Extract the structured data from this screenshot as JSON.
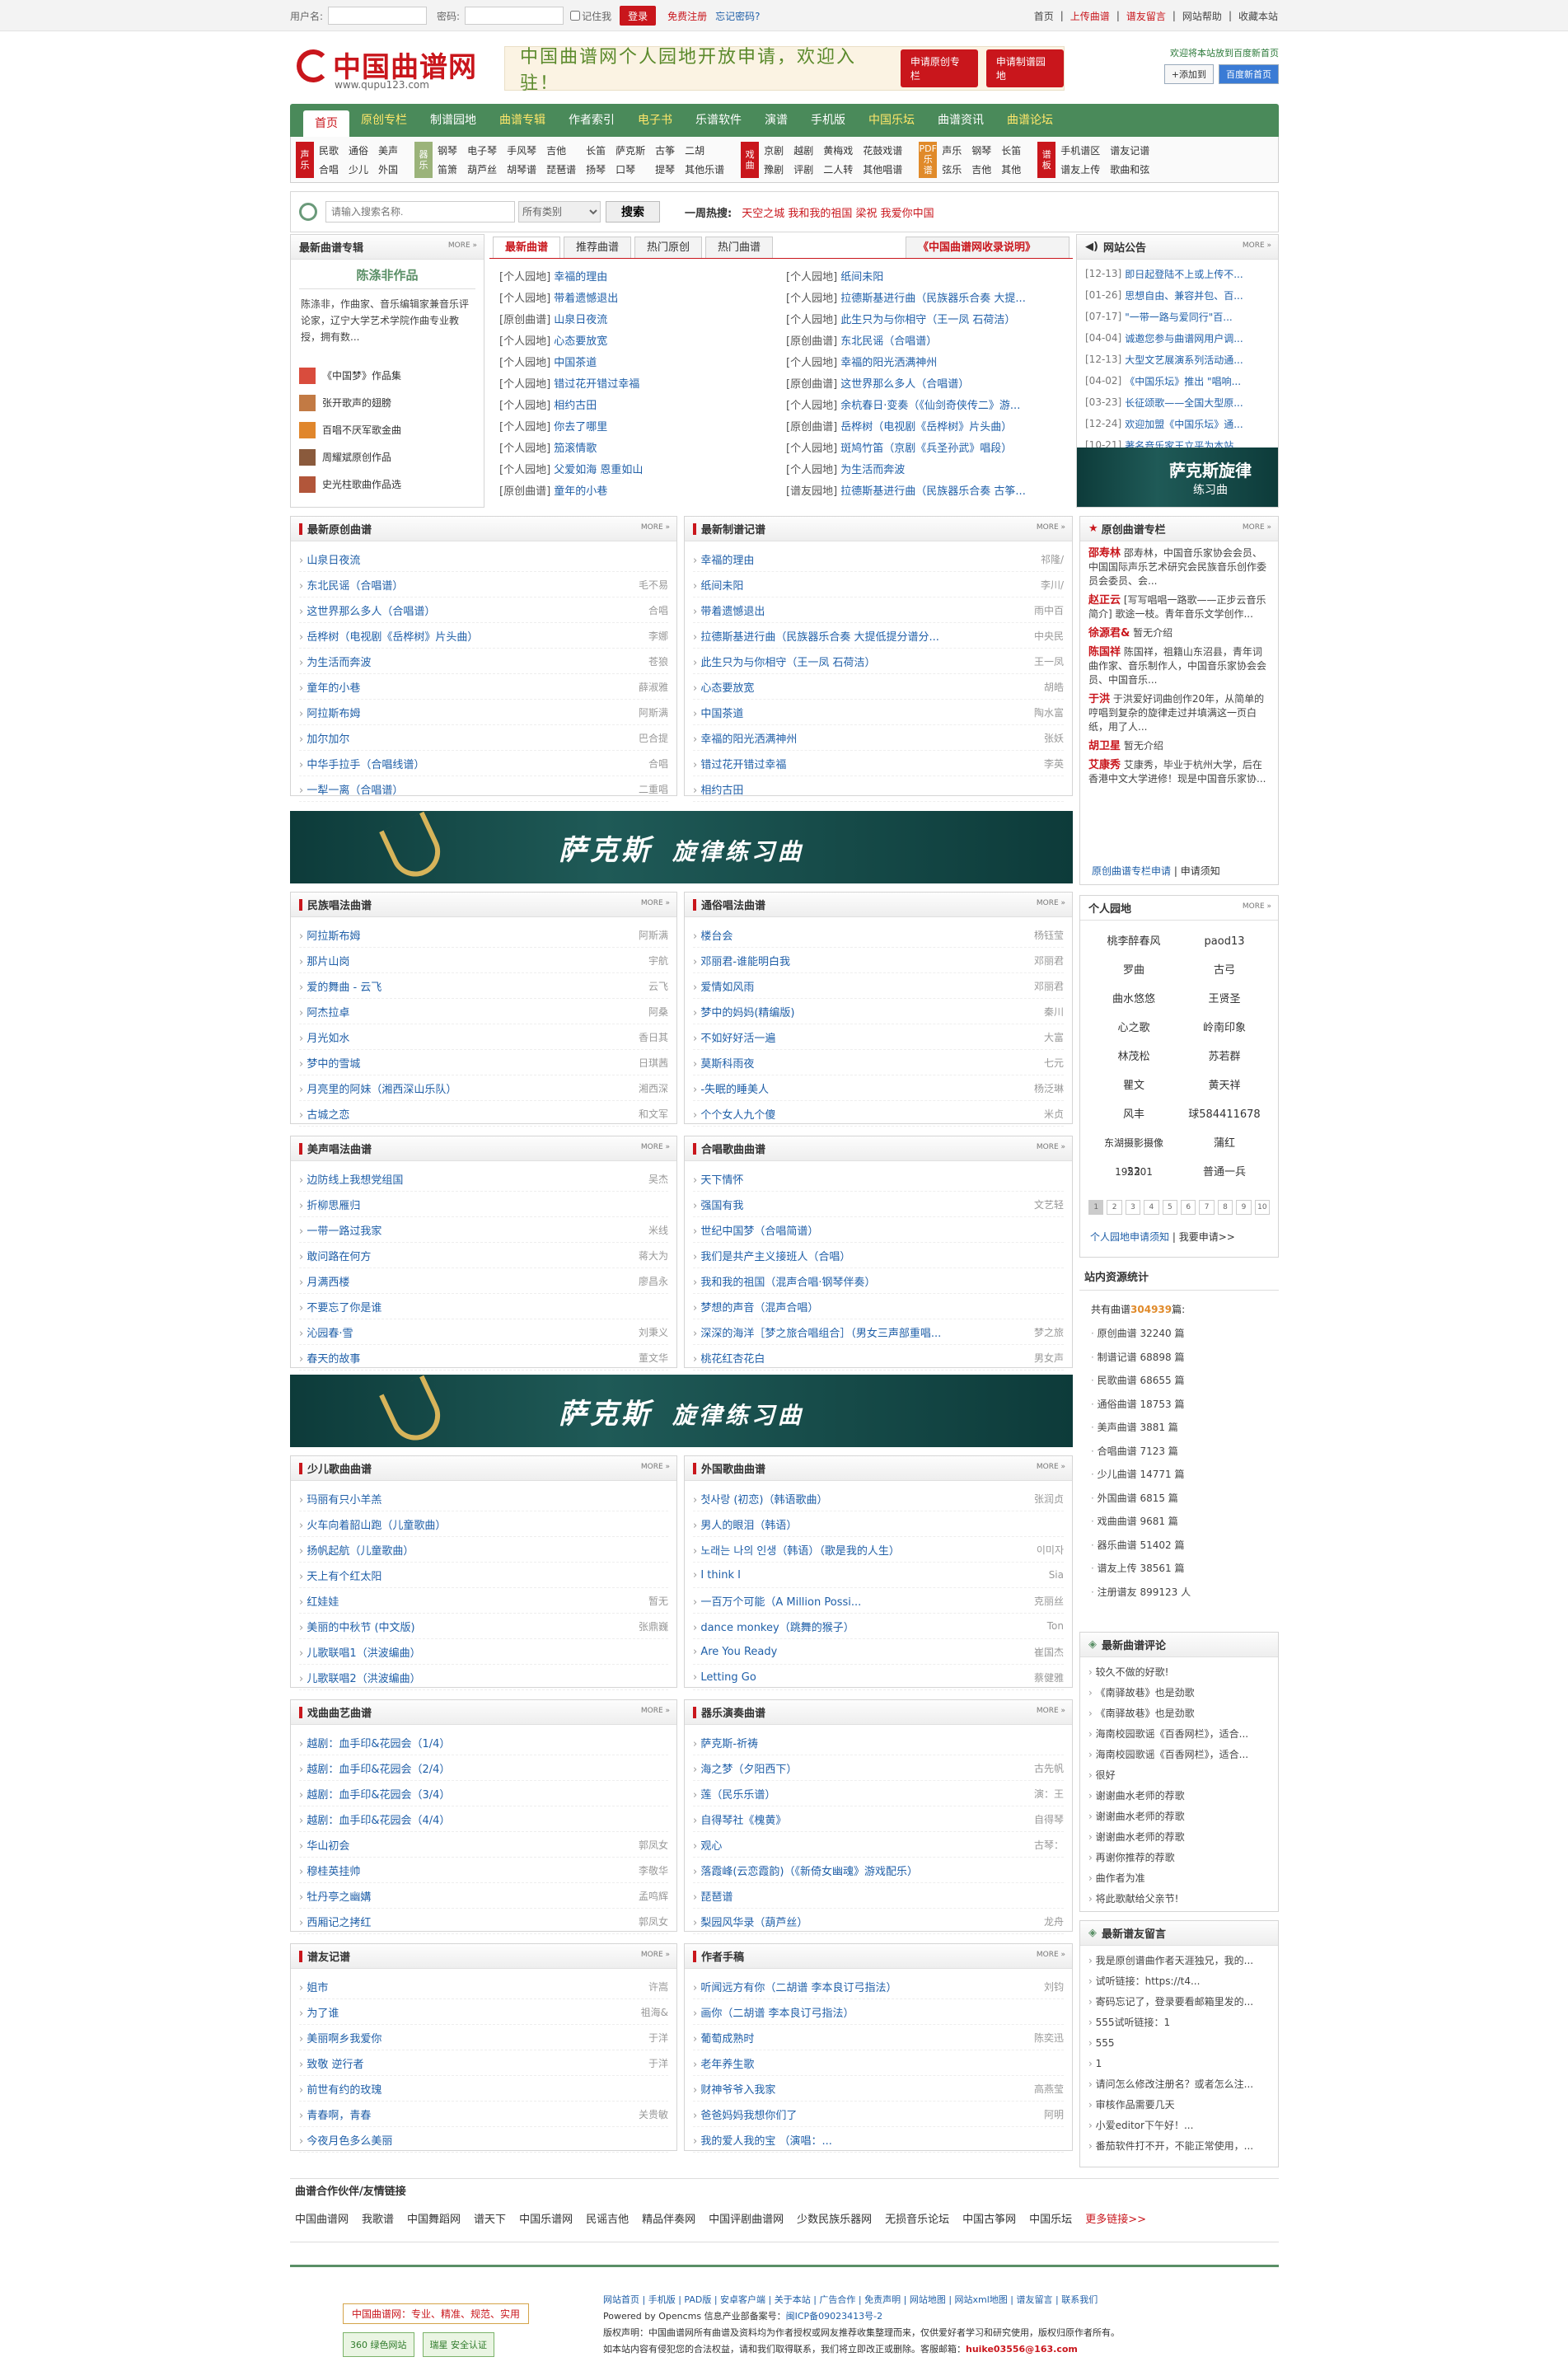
{
  "topbar": {
    "user_label": "用户名:",
    "pass_label": "密码:",
    "remember": "记住我",
    "login": "登录",
    "register": "免费注册",
    "forgot": "忘记密码?",
    "links": [
      "首页",
      "上传曲谱",
      "谱友留言",
      "网站帮助",
      "收藏本站"
    ]
  },
  "header": {
    "logo": "中国曲谱网",
    "url": "www.qupu123.com",
    "slogan": "中国曲谱网个人园地开放申请，欢迎入驻！",
    "btn1": "申请原创专栏",
    "btn2": "申请制谱园地",
    "right_note": "欢迎将本站放到百度新首页",
    "add": "+添加到",
    "baidu": "百度新首页"
  },
  "nav": [
    "首页",
    "原创专栏",
    "制谱园地",
    "曲谱专辑",
    "作者索引",
    "电子书",
    "乐谱软件",
    "演谱",
    "手机版",
    "中国乐坛",
    "曲谱资讯",
    "曲谱论坛"
  ],
  "cats": [
    {
      "tag": "声乐",
      "items": [
        "民歌",
        "通俗",
        "美声",
        "合唱",
        "少儿",
        "外国"
      ]
    },
    {
      "tag": "器乐",
      "items": [
        "钢琴",
        "电子琴",
        "手风琴",
        "吉他",
        "长笛",
        "萨克斯",
        "古筝",
        "二胡",
        "笛箫",
        "葫芦丝",
        "胡琴谱",
        "琵琶谱",
        "扬琴",
        "口琴",
        "提琴",
        "其他乐谱"
      ]
    },
    {
      "tag": "戏曲",
      "items": [
        "京剧",
        "越剧",
        "黄梅戏",
        "花鼓戏谱",
        "豫剧",
        "评剧",
        "二人转",
        "其他唱谱"
      ]
    },
    {
      "tag": "PDF乐谱",
      "items": [
        "声乐",
        "钢琴",
        "长笛",
        "弦乐",
        "吉他",
        "其他"
      ]
    },
    {
      "tag": "谱板",
      "items": [
        "手机谱区",
        "谱友记谱",
        "谱友上传",
        "歌曲和弦"
      ]
    }
  ],
  "search": {
    "placeholder": "请输入搜索名称.",
    "select": "所有类别",
    "btn": "搜索",
    "hot_label": "一周热搜:",
    "hot_words": "天空之城  我和我的祖国  梁祝  我爱你中国"
  },
  "album": {
    "title": "最新曲谱专辑",
    "person": "陈涤非作品",
    "desc": "陈涤非，作曲家、音乐编辑家兼音乐评论家，辽宁大学艺术学院作曲专业教授，拥有数...",
    "items": [
      "《中国梦》作品集",
      "张开歌声的翅膀",
      "百唱不厌军歌金曲",
      "周耀斌原创作品",
      "史光柱歌曲作品选"
    ]
  },
  "latest": {
    "tabs": [
      "最新曲谱",
      "推荐曲谱",
      "热门原创",
      "热门曲谱"
    ],
    "record": "《中国曲谱网收录说明》",
    "left": [
      [
        "[个人园地]",
        "幸福的理由"
      ],
      [
        "[个人园地]",
        "带着遗憾退出"
      ],
      [
        "[原创曲谱]",
        "山泉日夜流"
      ],
      [
        "[个人园地]",
        "心态要放宽"
      ],
      [
        "[个人园地]",
        "中国茶道"
      ],
      [
        "[个人园地]",
        "错过花开错过幸福"
      ],
      [
        "[个人园地]",
        "相约古田"
      ],
      [
        "[个人园地]",
        "你去了哪里"
      ],
      [
        "[个人园地]",
        "笳滚情歌"
      ],
      [
        "[个人园地]",
        "父爱如海 恩重如山"
      ],
      [
        "[原创曲谱]",
        "童年的小巷"
      ]
    ],
    "right": [
      [
        "[个人园地]",
        "纸间未阳"
      ],
      [
        "[个人园地]",
        "拉德斯基进行曲（民族器乐合奏 大提..."
      ],
      [
        "[个人园地]",
        "此生只为与你相守（王一凤 石荷洁）"
      ],
      [
        "[原创曲谱]",
        "东北民谣（合唱谱）"
      ],
      [
        "[个人园地]",
        "幸福的阳光洒满神州"
      ],
      [
        "[原创曲谱]",
        "这世界那么多人（合唱谱）"
      ],
      [
        "[个人园地]",
        "余杭春日·变奏（《仙剑奇侠传二》游..."
      ],
      [
        "[原创曲谱]",
        "岳桦树（电视剧《岳桦树》片头曲）"
      ],
      [
        "[个人园地]",
        "斑鸠竹笛（京剧《兵圣孙武》唱段）"
      ],
      [
        "[个人园地]",
        "为生活而奔波"
      ],
      [
        "[谱友园地]",
        "拉德斯基进行曲（民族器乐合奏 古筝..."
      ]
    ]
  },
  "notice": {
    "title": "网站公告",
    "items": [
      [
        "[12-13]",
        "即日起登陆不上或上传不..."
      ],
      [
        "[01-26]",
        "思想自由、兼容并包、百..."
      ],
      [
        "[07-17]",
        "\"一带一路与爱同行\"百..."
      ],
      [
        "[04-04]",
        "诚邀您参与曲谱网用户调..."
      ],
      [
        "[12-13]",
        "大型文艺展演系列活动通..."
      ],
      [
        "[04-02]",
        "《中国乐坛》推出 \"唱响..."
      ],
      [
        "[03-23]",
        "长征颂歌——全国大型原..."
      ],
      [
        "[12-24]",
        "欢迎加盟《中国乐坛》通..."
      ],
      [
        "[10-21]",
        "著名音乐家王立平为本站..."
      ]
    ],
    "banner": "萨克斯旋律",
    "banner_sub": "练习曲"
  },
  "orig": {
    "title": "最新原创曲谱",
    "rows": [
      [
        "山泉日夜流",
        ""
      ],
      [
        "东北民谣（合唱谱）",
        "毛不易"
      ],
      [
        "这世界那么多人（合唱谱）",
        "合唱"
      ],
      [
        "岳桦树（电视剧《岳桦树》片头曲）",
        "李娜"
      ],
      [
        "为生活而奔波",
        "苍狼"
      ],
      [
        "童年的小巷",
        "薛淑雅"
      ],
      [
        "阿拉斯布姆",
        "阿斯满"
      ],
      [
        "加尔加尔",
        "巴合提"
      ],
      [
        "中华手拉手（合唱线谱）",
        "合唱"
      ],
      [
        "一犁一离（合唱谱）",
        "二重唱"
      ]
    ]
  },
  "made": {
    "title": "最新制谱记谱",
    "rows": [
      [
        "幸福的理由",
        "祁隆/"
      ],
      [
        "纸间未阳",
        "李川/"
      ],
      [
        "带着遗憾退出",
        "雨中百"
      ],
      [
        "拉德斯基进行曲（民族器乐合奏 大提低提分谱分...",
        "中央民"
      ],
      [
        "此生只为与你相守（王一凤 石荷洁）",
        "王一凤"
      ],
      [
        "心态要放宽",
        "胡皓"
      ],
      [
        "中国茶道",
        "陶水富"
      ],
      [
        "幸福的阳光洒满神州",
        "张妖"
      ],
      [
        "错过花开错过幸福",
        "李英"
      ],
      [
        "相约古田",
        ""
      ]
    ]
  },
  "column": {
    "title": "原创曲谱专栏",
    "people": [
      [
        "邵寿林",
        "邵寿林，中国音乐家协会会员、中国国际声乐艺术研究会民族音乐创作委员会委员、会..."
      ],
      [
        "赵正云",
        "[写写唱唱一路歌——正步云音乐简介] 歌途一枝。青年音乐文学创作..."
      ],
      [
        "徐源君&",
        "暂无介绍"
      ],
      [
        "陈国祥",
        "陈国祥，祖籍山东沼县，青年词曲作家、音乐制作人，中国音乐家协会会员、中国音乐..."
      ],
      [
        "于洪",
        "于洪爱好词曲创作20年，从简单的哼唱到复杂的旋律走过并填满这一页白纸，用了人..."
      ],
      [
        "胡卫星",
        "暂无介绍"
      ],
      [
        "艾康秀",
        "艾康秀，毕业于杭州大学，后在香港中文大学进修！现是中国音乐家协..."
      ]
    ],
    "apply": "原创曲谱专栏申请",
    "notice": "申请须知"
  },
  "folk": {
    "title": "民族唱法曲谱",
    "rows": [
      [
        "阿拉斯布姆",
        "阿斯满"
      ],
      [
        "那片山岗",
        "宇航"
      ],
      [
        "爱的舞曲 - 云飞",
        "云飞"
      ],
      [
        "阿杰拉卓",
        "阿桑"
      ],
      [
        "月光如水",
        "香日其"
      ],
      [
        "梦中的雪城",
        "日琪茜"
      ],
      [
        "月亮里的阿妹（湘西深山乐队）",
        "湘西深"
      ],
      [
        "古城之恋",
        "和文军"
      ]
    ]
  },
  "pop": {
    "title": "通俗唱法曲谱",
    "rows": [
      [
        "楼台会",
        "杨钰莹"
      ],
      [
        "邓丽君-谁能明白我",
        "邓丽君"
      ],
      [
        "爱情如风雨",
        "邓丽君"
      ],
      [
        "梦中的妈妈(精编版)",
        "秦川"
      ],
      [
        "不如好好活一遍",
        "大富"
      ],
      [
        "莫斯科雨夜",
        "七元"
      ],
      [
        "-失眠的睡美人",
        "杨泛琳"
      ],
      [
        "个个女人九个傻",
        "米贞"
      ]
    ]
  },
  "bel": {
    "title": "美声唱法曲谱",
    "rows": [
      [
        "边防线上我想党组国",
        "吴杰"
      ],
      [
        "折柳思雁归",
        ""
      ],
      [
        "一带一路过我家",
        "米线"
      ],
      [
        "敢问路在何方",
        "蒋大为"
      ],
      [
        "月满西楼",
        "廖昌永"
      ],
      [
        "不要忘了你是谁",
        ""
      ],
      [
        "沁园春·雪",
        "刘秉义"
      ],
      [
        "春天的故事",
        "董文华"
      ]
    ]
  },
  "chorus": {
    "title": "合唱歌曲曲谱",
    "rows": [
      [
        "天下情怀",
        ""
      ],
      [
        "强国有我",
        "文艺轻"
      ],
      [
        "世纪中国梦（合唱简谱）",
        ""
      ],
      [
        "我们是共产主义接班人（合唱）",
        ""
      ],
      [
        "我和我的祖国（混声合唱·钢琴伴奏）",
        ""
      ],
      [
        "梦想的声音（混声合唱）",
        ""
      ],
      [
        "深深的海洋［梦之旅合唱组合］（男女三声部重唱...",
        "梦之旅"
      ],
      [
        "桃花红杏花白",
        "男女声"
      ]
    ]
  },
  "kids": {
    "title": "少儿歌曲曲谱",
    "rows": [
      [
        "玛丽有只小羊羔",
        ""
      ],
      [
        "火车向着韶山跑（儿童歌曲）",
        ""
      ],
      [
        "扬帆起航（儿童歌曲）",
        ""
      ],
      [
        "天上有个红太阳",
        ""
      ],
      [
        "红娃娃",
        "暂无"
      ],
      [
        "美丽的中秋节 (中文版)",
        "张鼎巍"
      ],
      [
        "儿歌联唱1（洪波编曲）",
        ""
      ],
      [
        "儿歌联唱2（洪波编曲）",
        ""
      ]
    ]
  },
  "foreign": {
    "title": "外国歌曲曲谱",
    "rows": [
      [
        "첫사랑 (初恋)（韩语歌曲）",
        "张润贞"
      ],
      [
        "男人的眼泪（韩语）",
        ""
      ],
      [
        "노래는 나의 인생（韩语）（歌是我的人生）",
        "이미자"
      ],
      [
        "I think I",
        "Sia"
      ],
      [
        "一百万个可能（A Million Possi...",
        "克丽丝"
      ],
      [
        "dance monkey（跳舞的猴子）",
        "Ton"
      ],
      [
        "Are You Ready",
        "崔国杰"
      ],
      [
        "Letting Go",
        "蔡健雅"
      ]
    ]
  },
  "opera": {
    "title": "戏曲曲艺曲谱",
    "rows": [
      [
        "越剧：血手印&花园会（1/4）",
        ""
      ],
      [
        "越剧：血手印&花园会（2/4）",
        ""
      ],
      [
        "越剧：血手印&花园会（3/4）",
        ""
      ],
      [
        "越剧：血手印&花园会（4/4）",
        ""
      ],
      [
        "华山初会",
        "郭凤女"
      ],
      [
        "穆桂英挂帅",
        "李敬华"
      ],
      [
        "牡丹亭之幽媾",
        "孟鸣辉"
      ],
      [
        "西厢记之拷红",
        "郭凤女"
      ]
    ]
  },
  "instr": {
    "title": "器乐演奏曲谱",
    "rows": [
      [
        "萨克斯-祈祷",
        ""
      ],
      [
        "海之梦（夕阳西下）",
        "古先帆"
      ],
      [
        "莲（民乐乐谱）",
        "演：王"
      ],
      [
        "自得琴社《槐黄》",
        "自得琴"
      ],
      [
        "观心",
        "古琴："
      ],
      [
        "落霞峰(云恋霞韵)（《新倚女幽魂》游戏配乐）",
        ""
      ],
      [
        "琵琶谱",
        ""
      ],
      [
        "梨园风华录（葫芦丝）",
        "龙舟"
      ]
    ]
  },
  "friendrec": {
    "title": "谱友记谱",
    "rows": [
      [
        "姐市",
        "许嵩"
      ],
      [
        "为了谁",
        "祖海&"
      ],
      [
        "美丽啊乡我爱你",
        "于洋"
      ],
      [
        "致敬 逆行者",
        "于洋"
      ],
      [
        "前世有约的玫瑰",
        ""
      ],
      [
        "青春啊，青春",
        "关贵敏"
      ],
      [
        "今夜月色多么美丽",
        ""
      ]
    ]
  },
  "authors": {
    "title": "作者手稿",
    "rows": [
      [
        "听闻远方有你（二胡谱 李本良订弓指法）",
        "刘钧"
      ],
      [
        "画你（二胡谱 李本良订弓指法）",
        ""
      ],
      [
        "葡萄成熟时",
        "陈奕迅"
      ],
      [
        "老年养生歌",
        ""
      ],
      [
        "财神爷爷入我家",
        "高燕莹"
      ],
      [
        "爸爸妈妈我想你们了",
        "阿明"
      ],
      [
        "我的爱人我的宝 （演唱：...",
        ""
      ]
    ]
  },
  "gardens": {
    "title": "个人园地",
    "names": [
      "桃李醉春风",
      "paod13",
      "罗曲",
      "古弓",
      "曲水悠悠",
      "王贤圣",
      "心之歌",
      "岭南印象",
      "林茂松",
      "苏若群",
      "瞿文",
      "黄天祥",
      "风丰",
      "球584411678",
      "东湖摄影摄像195301",
      "蒲红",
      "22",
      "普通一兵"
    ],
    "pages": [
      "1",
      "2",
      "3",
      "4",
      "5",
      "6",
      "7",
      "8",
      "9",
      "10"
    ],
    "apply": "个人园地申请须知",
    "want": "我要申请>>"
  },
  "stats": {
    "title": "站内资源统计",
    "total_label": "共有曲谱",
    "total": "304939",
    "unit": "篇:",
    "rows": [
      "原创曲谱 32240 篇",
      "制谱记谱 68898 篇",
      "民歌曲谱 68655 篇",
      "通俗曲谱 18753 篇",
      "美声曲谱 3881 篇",
      "合唱曲谱 7123 篇",
      "少儿曲谱 14771 篇",
      "外国曲谱 6815 篇",
      "戏曲曲谱 9681 篇",
      "器乐曲谱 51402 篇",
      "谱友上传 38561 篇",
      "注册谱友 899123 人"
    ]
  },
  "comments": {
    "title": "最新曲谱评论",
    "rows": [
      "较久不做的好歌!",
      "《南驿故巷》也是劲歌",
      "《南驿故巷》也是劲歌",
      "海南校园歌谣《百香网栏》，适合...",
      "海南校园歌谣《百香网栏》，适合...",
      "很好",
      "谢谢曲水老师的荐歌",
      "谢谢曲水老师的荐歌",
      "谢谢曲水老师的荐歌",
      "再谢你推荐的荐歌",
      "曲作者为准",
      "将此歌献给父亲节!"
    ]
  },
  "messages": {
    "title": "最新谱友留言",
    "rows": [
      "我是原创谱曲作者天涯独兄，我的...",
      "试听链接：https://t4...",
      "寄码忘记了，登录要看邮箱里发的...",
      "555试听链接：1",
      "555",
      "1",
      "请问怎么修改注册名？或者怎么注...",
      "审核作品需要几天",
      "小爱editor下午好！...",
      "番茄软件打不开，不能正常使用，..."
    ]
  },
  "friends": {
    "title": "曲谱合作伙伴/友情链接",
    "links": [
      "中国曲谱网",
      "我歌谱",
      "中国舞蹈网",
      "谱天下",
      "中国乐谱网",
      "民谣吉他",
      "精品伴奏网",
      "中国评剧曲谱网",
      "少数民族乐器网",
      "无损音乐论坛",
      "中国古筝网",
      "中国乐坛"
    ],
    "more": "更多链接>>"
  },
  "footer": {
    "slogan": "中国曲谱网：专业、精准、规范、实用",
    "badge1": "360 绿色网站",
    "badge2": "瑞星 安全认证",
    "links": "网站首页 | 手机版 | PAD版 | 安卓客户端 | 关于本站 | 广告合作 | 免责声明 | 网站地图 | 网站xml地图 | 谱友留言 | 联系我们",
    "powered": "Powered by Opencms 信息产业部备案号：",
    "icp": "闽ICP备09023413号-2",
    "copy1": "版权声明：中国曲谱网所有曲谱及资料均为作者授权或网友推荐收集整理而来，仅供爱好者学习和研究使用，版权归原作者所有。",
    "copy2": "如本站内容有侵犯您的合法权益，请和我们取得联系，我们将立即改正或删除。客服邮箱：",
    "email": "huike03556@163.com"
  }
}
